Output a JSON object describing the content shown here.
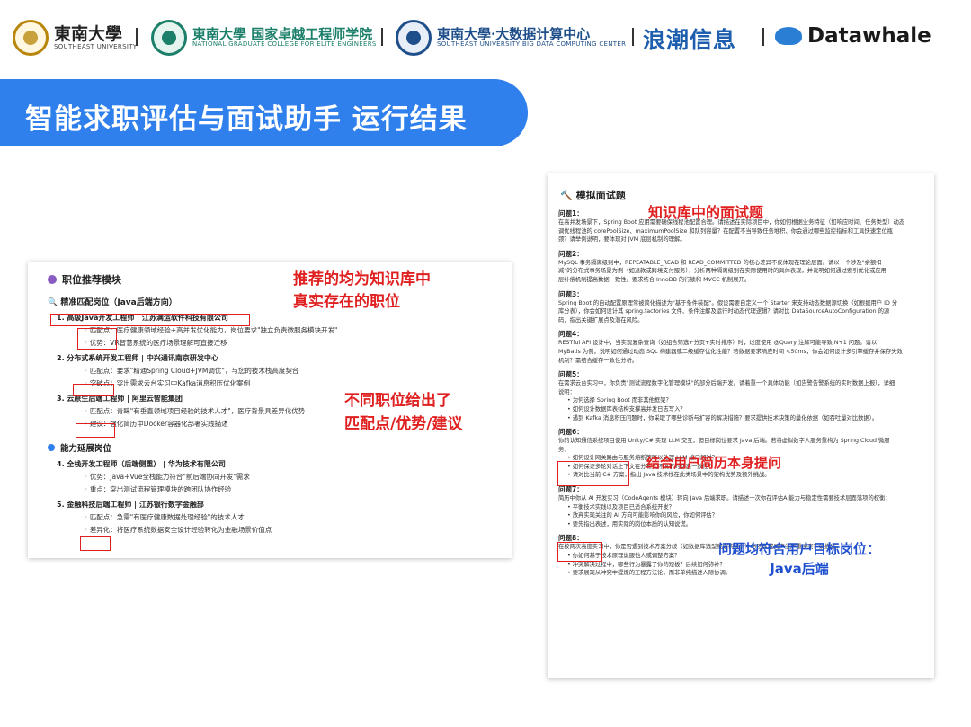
{
  "header": {
    "seu": {
      "main": "東南大學",
      "sub": "SOUTHEAST UNIVERSITY"
    },
    "college": {
      "main": "東南大學 国家卓越工程师学院",
      "sub": "NATIONAL GRADUATE COLLEGE FOR ELITE ENGINEERS"
    },
    "bigdata": {
      "main": "東南大學·大数据计算中心",
      "sub": "SOUTHEAST UNIVERSITY BIG DATA COMPUTING CENTER"
    },
    "inspur": "浪潮信息",
    "datawhale": "Datawhale"
  },
  "banner": {
    "title": "智能求职评估与面试助手 运行结果"
  },
  "left_card": {
    "section1_title": "职位推荐模块",
    "sub1": "精准匹配岗位（Java后端方向）",
    "jobs": [
      {
        "title": "1. 高级Java开发工程师 | 江苏满运软件科技有限公司",
        "bullets": [
          "匹配点：医疗健康领域经验+高并发优化能力，岗位要求\"独立负责微服务模块开发\"",
          "优势：VR智慧系统的医疗场景理解可直接迁移"
        ]
      },
      {
        "title": "2. 分布式系统开发工程师 | 中兴通讯南京研发中心",
        "bullets": [
          "匹配点：要求\"精通Spring Cloud+JVM调优\"，与您的技术栈高度契合",
          "突破点：突出需求云台实习中Kafka消息积压优化案例"
        ]
      },
      {
        "title": "3. 云原生后端工程师 | 阿里云智能集团",
        "bullets": [
          "匹配点：青睐\"有垂直领域项目经验的技术人才\"，医疗背景具差异化优势",
          "建议：强化简历中Docker容器化部署实践描述"
        ]
      }
    ],
    "section2_title": "能力延展岗位",
    "jobs2": [
      {
        "title": "4. 全栈开发工程师（后端侧重） | 华为技术有限公司",
        "bullets": [
          "优势：Java+Vue全栈能力符合\"前后端协同开发\"需求",
          "重点：突出测试流程管理模块的跨团队协作经验"
        ]
      },
      {
        "title": "5. 金融科技后端工程师 | 江苏银行数字金融部",
        "bullets": [
          "匹配点：急需\"有医疗健康数据处理经验\"的技术人才",
          "差异化：将医疗系统数据安全设计经验转化为金融场景价值点"
        ]
      }
    ],
    "annotation1": [
      "推荐的均为知识库中",
      "真实存在的职位"
    ],
    "annotation2": [
      "不同职位给出了",
      "匹配点/优势/建议"
    ]
  },
  "right_card": {
    "title": "模拟面试题",
    "annotation_top": "知识库中的面试题",
    "annotation_mid": "结合用户简历本身提问",
    "annotation_bottom": [
      "问题均符合用户目标岗位：",
      "Java后端"
    ],
    "questions": [
      {
        "label": "问题1：",
        "lines": [
          "在高并发场景下，Spring Boot 应用需要确保线程池配置合理。请描述在实际项目中，你如何根据业务特征（如响应时间、任务类型）动态",
          "调优线程池的 corePoolSize、maximumPoolSize 和队列容量？在配置不当导致任务堆积、你会通过哪些监控指标和工具快速定位瓶",
          "颈？请举例说明，要体现对 JVM 底层机制的理解。"
        ]
      },
      {
        "label": "问题2：",
        "lines": [
          "MySQL 事务隔离级别中，REPEATABLE_READ 和 READ_COMMITTED 的核心差异不仅体现在理论层面。请以一个涉及\"余额扣",
          "减\"的分布式事务场景为例（如退款或跨境支付服务），分析两种隔离级别在实际使用时的具体表现，并说明如何通过索引优化或应用",
          "层补偿机制提高数据一致性。要求结合 InnoDB 的行锁和 MVCC 机制展开。"
        ]
      },
      {
        "label": "问题3：",
        "lines": [
          "Spring Boot 的自动配置原理常被简化描述为\"基于条件装配\"。假设需要自定义一个 Starter 来支持动态数据源切换（如根据用户 ID 分",
          "库分表），你会如何设计其 spring.factories 文件、条件注解及运行时动态代理逻辑？请对比 DataSourceAutoConfiguration 的源",
          "码，指出关键扩展点及潜在风险。"
        ]
      },
      {
        "label": "问题4：",
        "lines": [
          "RESTful API 设计中，当实现复杂查询（如组合筛选+分页+实时排序）时，过度使用 @Query 注解可能导致 N+1 问题。请以",
          "MyBatis 为例，说明如何通过动态 SQL 构建器或二级缓存优化性能？若数据要求响应时间 <50ms，你会如何设计多引擎缓存并保存失效",
          "机制？需结合缓存一致性分析。"
        ]
      },
      {
        "label": "问题5：",
        "lines": [
          "在需求云台实习中，你负责\"测试流程数字化管理模块\"的部分后端开发。请着重一个具体功能（如告警告警系统的实时数据上报），详细",
          "说明："
        ]
      },
      {
        "label": "",
        "li": [
          "为何选择 Spring Boot 而非其他框架？",
          "如何设计数据库表结构支撑高并发日志写入？",
          "遇到 Kafka 消息积压问题时，你采取了哪些诊断与扩容的解决措施？要求提供技术决策的量化依据（如吞吐量对比数据）。"
        ]
      },
      {
        "label": "问题6：",
        "lines": [
          "你的认知通信系统项目使用 Unity/C# 实现 LLM 交互，但目标岗位要求 Java 后端。若将虚拟数字人服务重构为 Spring Cloud 微服",
          "务："
        ]
      },
      {
        "label": "",
        "li": [
          "如何设计网关路由与服务熔断策略以处理 LLM 接口超时？",
          "如何保证多轮对话上下文在分布式环境下的状态一致性？",
          "请对比当前 C# 方案，指出 Java 技术栈在此类场景中的架构优势及额外挑战。"
        ]
      },
      {
        "label": "问题7：",
        "lines": [
          "简历中你从 AI 开发实习（CodeAgents 模块）转向 Java 后端求职。请描述一次你在评估AI能力与稳定性需要技术层面落项的权衡："
        ]
      },
      {
        "label": "",
        "li": [
          "平衡技术实践以及项目已适合系统开发？",
          "放弃实现关注的 AI 方向可能影响你的风险，你如何评估？",
          "要先指出表述，用实际的岗位本质的认知说谎。"
        ]
      },
      {
        "label": "问题8：",
        "lines": [
          "在校两次高度实习中，你是否遇到技术方案分歧（如数据库选型或架构设计）与团队成员产生严重冲突？请描述："
        ]
      },
      {
        "label": "",
        "li": [
          "你如何基于技术原理说服他人或调整方案？",
          "冲突解决过程中，哪些行为暴露了你的短板？后续如何弥补？",
          "要求展现从冲突中提炼的工程方法论，而非单纯描述人际协调。"
        ]
      }
    ]
  },
  "colors": {
    "accent": "#2f80ed",
    "annotation_red": "#e02020",
    "annotation_blue": "#1e4fcf"
  }
}
